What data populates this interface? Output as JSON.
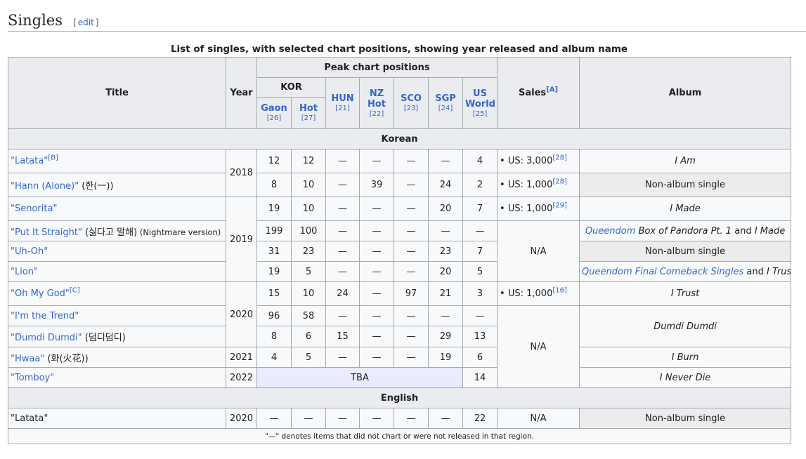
{
  "section": {
    "title": "Singles",
    "edit_open": "[",
    "edit_label": "edit",
    "edit_close": "]"
  },
  "caption": "List of singles, with selected chart positions, showing year released and album name",
  "headers": {
    "title": "Title",
    "year": "Year",
    "peak": "Peak chart positions",
    "kor": "KOR",
    "gaon": "Gaon",
    "gaon_ref": "[26]",
    "hot": "Hot",
    "hot_ref": "[27]",
    "hun": "HUN",
    "hun_ref": "[21]",
    "nz": "NZ",
    "nz2": "Hot",
    "nz_ref": "[22]",
    "sco": "SCO",
    "sco_ref": "[23]",
    "sgp": "SGP",
    "sgp_ref": "[24]",
    "us": "US",
    "us2": "World",
    "us_ref": "[25]",
    "sales": "Sales",
    "sales_ref": "[A]",
    "album": "Album"
  },
  "sections": {
    "korean": "Korean",
    "english": "English"
  },
  "rows": [
    {
      "title": "\"Latata\"",
      "title_ref": "[B]",
      "year": "2018",
      "gaon": "12",
      "hot": "12",
      "hun": "—",
      "nz": "—",
      "sco": "—",
      "sgp": "—",
      "us": "4",
      "sales": "US: 3,000",
      "sales_ref": "[28]",
      "album": "I Am"
    },
    {
      "title": "\"Hann (Alone)\"",
      "title_extra": " (한(一))",
      "gaon": "8",
      "hot": "10",
      "hun": "—",
      "nz": "39",
      "sco": "—",
      "sgp": "24",
      "us": "2",
      "sales": "US: 1,000",
      "sales_ref": "[28]",
      "album": "Non-album single"
    },
    {
      "title": "\"Senorita\"",
      "year": "2019",
      "gaon": "19",
      "hot": "10",
      "hun": "—",
      "nz": "—",
      "sco": "—",
      "sgp": "20",
      "us": "7",
      "sales": "US: 1,000",
      "sales_ref": "[29]",
      "album": "I Made"
    },
    {
      "title": "\"Put It Straight\"",
      "title_extra": " (싫다고 말해)",
      "title_small": " (Nightmare version)",
      "gaon": "199",
      "hot": "100",
      "hun": "—",
      "nz": "—",
      "sco": "—",
      "sgp": "—",
      "us": "—",
      "sales": "N/A",
      "album_link": "Queendom",
      "album_a": " Box of Pandora Pt. 1",
      "album_and": " and ",
      "album_b": "I Made"
    },
    {
      "title": "\"Uh-Oh\"",
      "gaon": "31",
      "hot": "23",
      "hun": "—",
      "nz": "—",
      "sco": "—",
      "sgp": "23",
      "us": "7",
      "album": "Non-album single"
    },
    {
      "title": "\"Lion\"",
      "gaon": "19",
      "hot": "5",
      "hun": "—",
      "nz": "—",
      "sco": "—",
      "sgp": "20",
      "us": "5",
      "album_link": "Queendom Final Comeback Singles",
      "album_and": " and ",
      "album_b": "I Trust"
    },
    {
      "title": "\"Oh My God\"",
      "title_ref": "[C]",
      "year": "2020",
      "gaon": "15",
      "hot": "10",
      "hun": "24",
      "nz": "—",
      "sco": "97",
      "sgp": "21",
      "us": "3",
      "sales": "US: 1,000",
      "sales_ref": "[16]",
      "album": "I Trust"
    },
    {
      "title": "\"I'm the Trend\"",
      "gaon": "96",
      "hot": "58",
      "hun": "—",
      "nz": "—",
      "sco": "—",
      "sgp": "—",
      "us": "—",
      "sales": "N/A",
      "album": "Dumdi Dumdi"
    },
    {
      "title": "\"Dumdi Dumdi\"",
      "title_extra": " (덤디덤디)",
      "gaon": "8",
      "hot": "6",
      "hun": "15",
      "nz": "—",
      "sco": "—",
      "sgp": "29",
      "us": "13"
    },
    {
      "title": "\"Hwaa\"",
      "title_extra": " (화(火花))",
      "year": "2021",
      "gaon": "4",
      "hot": "5",
      "hun": "—",
      "nz": "—",
      "sco": "—",
      "sgp": "19",
      "us": "6",
      "album": "I Burn"
    },
    {
      "title": "\"Tomboy\"",
      "year": "2022",
      "tba": "TBA",
      "us": "14",
      "album": "I Never Die"
    },
    {
      "title": "\"Latata\"",
      "year": "2020",
      "gaon": "—",
      "hot": "—",
      "hun": "—",
      "nz": "—",
      "sco": "—",
      "sgp": "—",
      "us": "22",
      "sales": "N/A",
      "album": "Non-album single"
    }
  ],
  "footnote": "\"—\" denotes items that did not chart or were not released in that region."
}
